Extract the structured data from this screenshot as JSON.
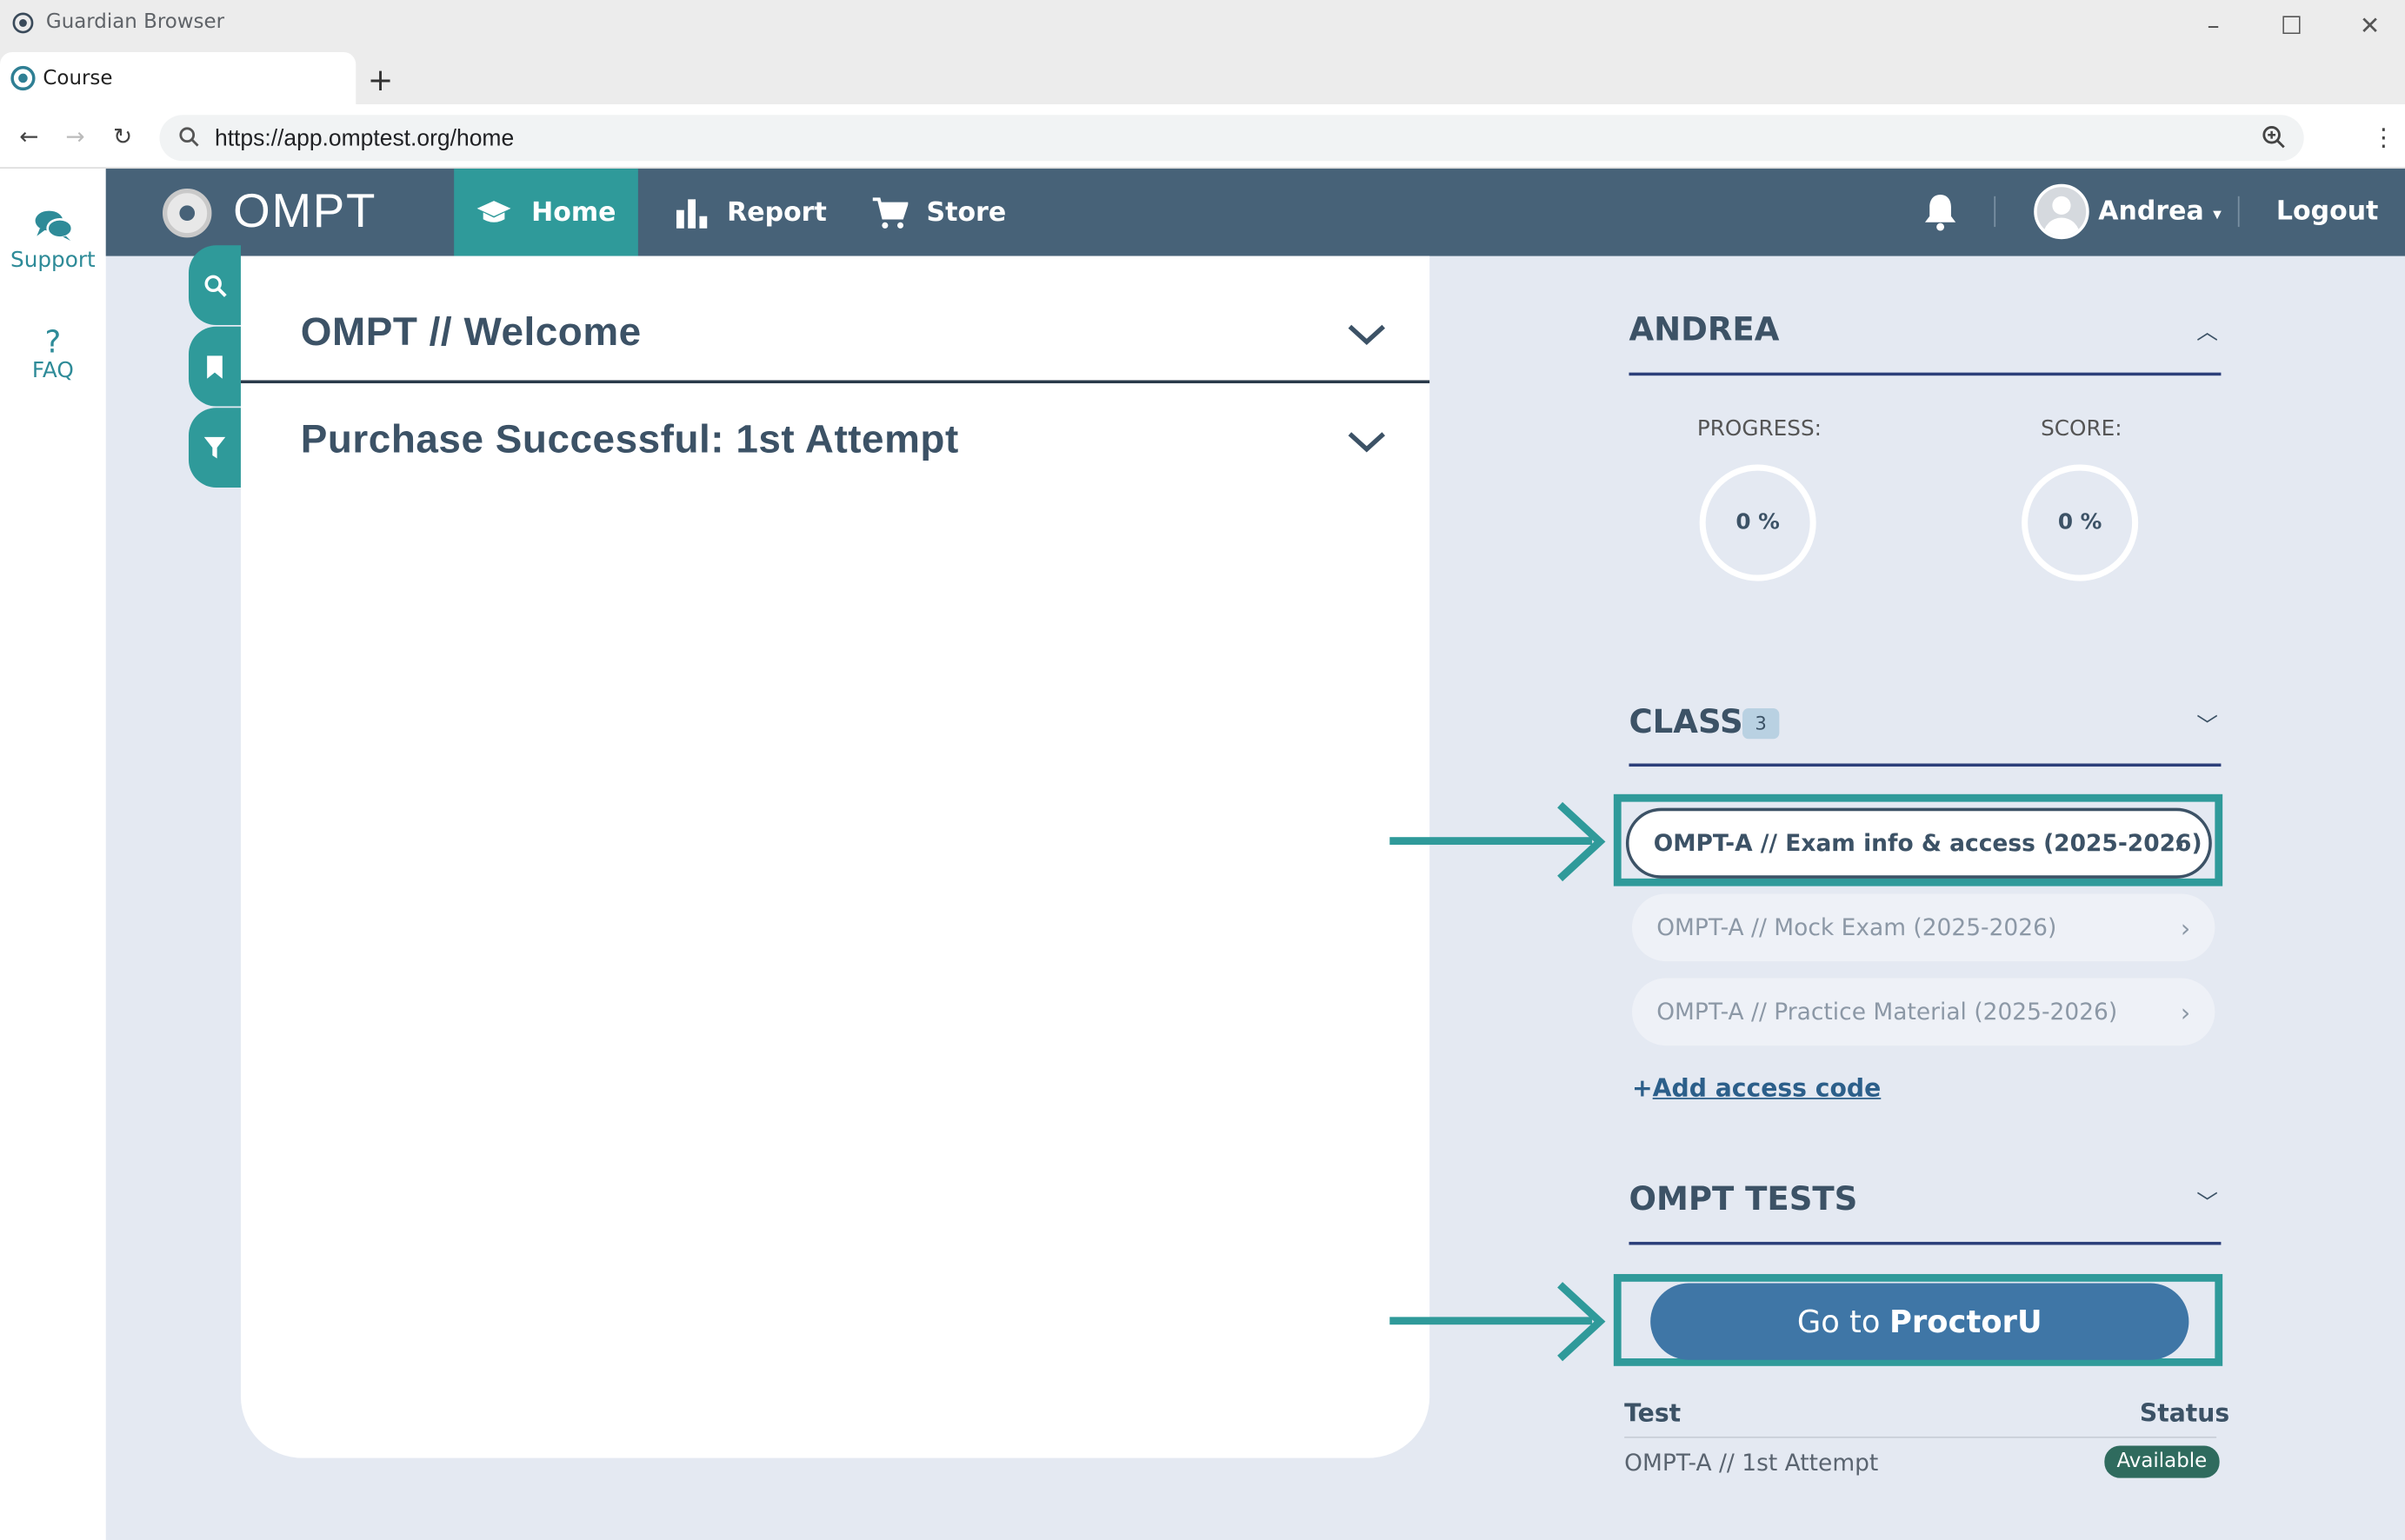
{
  "window": {
    "title": "Guardian Browser",
    "controls": {
      "minimize": "–",
      "maximize": "☐",
      "close": "✕"
    }
  },
  "tabs": [
    {
      "label": "Course"
    }
  ],
  "new_tab_icon": "+",
  "address_bar": {
    "url": "https://app.omptest.org/home"
  },
  "left_rail": {
    "items": [
      {
        "label": "Support",
        "icon": "chat-bubbles-icon"
      },
      {
        "label": "FAQ",
        "icon": "question-icon",
        "glyph": "?"
      }
    ]
  },
  "top_nav": {
    "brand": "OMPT",
    "items": [
      {
        "label": "Home",
        "icon": "graduation-cap-icon",
        "active": true
      },
      {
        "label": "Report",
        "icon": "bar-chart-icon"
      },
      {
        "label": "Store",
        "icon": "cart-icon"
      }
    ],
    "user": "Andrea",
    "logout": "Logout"
  },
  "main": {
    "accordions": [
      {
        "title": "OMPT // Welcome"
      },
      {
        "title": "Purchase Successful: 1st Attempt"
      }
    ]
  },
  "sidebar": {
    "user_section": {
      "title": "ANDREA",
      "progress_label": "PROGRESS:",
      "progress_value": "0 %",
      "score_label": "SCORE:",
      "score_value": "0 %"
    },
    "class_section": {
      "title": "CLASS",
      "count": "3",
      "items": [
        {
          "label": "OMPT-A // Exam info & access (2025-2026)",
          "active": true
        },
        {
          "label": "OMPT-A // Mock Exam (2025-2026)"
        },
        {
          "label": "OMPT-A // Practice Material (2025-2026)"
        }
      ],
      "add_code_plus": "+",
      "add_code": "Add access code"
    },
    "tests_section": {
      "title": "OMPT TESTS",
      "button_prefix": "Go to",
      "button_brand": "ProctorU",
      "columns": [
        "Test",
        "Status"
      ],
      "rows": [
        {
          "test": "OMPT-A // 1st Attempt",
          "status": "Available"
        }
      ]
    }
  },
  "colors": {
    "nav": "#476278",
    "accent": "#2f9a9a",
    "background": "#e4e9f2",
    "button": "#3f76a6",
    "status_available": "#2f6b5e"
  }
}
